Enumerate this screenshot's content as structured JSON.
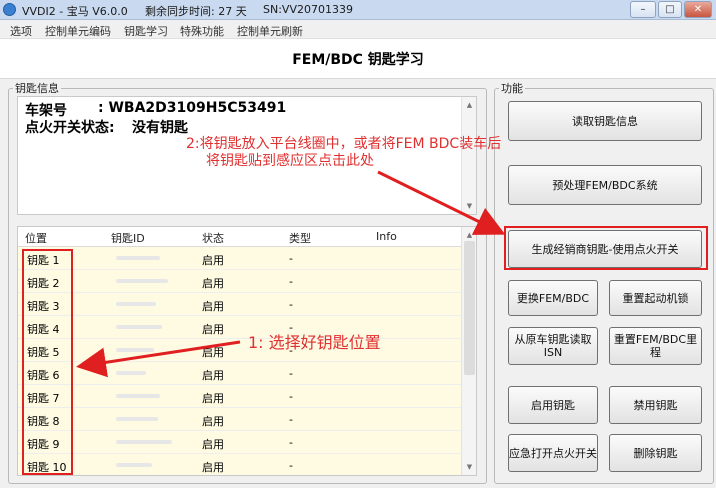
{
  "window": {
    "title_app": "VVDI2 - 宝马 V6.0.0",
    "title_sync": "剩余同步时间: 27 天",
    "title_sn": "SN:VV20701339"
  },
  "menu": [
    "选项",
    "控制单元编码",
    "钥匙学习",
    "特殊功能",
    "控制单元刷新"
  ],
  "header": {
    "title": "FEM/BDC 钥匙学习"
  },
  "key_info": {
    "legend": "钥匙信息",
    "vin_label": "车架号",
    "vin_value": ": WBA2D3109H5C53491",
    "ignition_label": "点火开关状态:",
    "ignition_value": "没有钥匙"
  },
  "annotations": {
    "hint2_line1": "2:将钥匙放入平台线圈中，或者将FEM BDC装车后",
    "hint2_line2": "将钥匙贴到感应区点击此处",
    "hint1": "1: 选择好钥匙位置",
    "color": "#e02020"
  },
  "table": {
    "headers": [
      "位置",
      "钥匙ID",
      "状态",
      "类型",
      "Info"
    ],
    "rows": [
      {
        "pos": "钥匙 1",
        "id": "",
        "status": "启用",
        "type": "-",
        "info": ""
      },
      {
        "pos": "钥匙 2",
        "id": "",
        "status": "启用",
        "type": "-",
        "info": ""
      },
      {
        "pos": "钥匙 3",
        "id": "",
        "status": "启用",
        "type": "-",
        "info": ""
      },
      {
        "pos": "钥匙 4",
        "id": "",
        "status": "启用",
        "type": "-",
        "info": ""
      },
      {
        "pos": "钥匙 5",
        "id": "",
        "status": "启用",
        "type": "-",
        "info": ""
      },
      {
        "pos": "钥匙 6",
        "id": "",
        "status": "启用",
        "type": "-",
        "info": ""
      },
      {
        "pos": "钥匙 7",
        "id": "",
        "status": "启用",
        "type": "-",
        "info": ""
      },
      {
        "pos": "钥匙 8",
        "id": "",
        "status": "启用",
        "type": "-",
        "info": ""
      },
      {
        "pos": "钥匙 9",
        "id": "",
        "status": "启用",
        "type": "-",
        "info": ""
      },
      {
        "pos": "钥匙 10",
        "id": "",
        "status": "启用",
        "type": "-",
        "info": ""
      }
    ],
    "row_bg": "#fffbe3"
  },
  "functions": {
    "legend": "功能",
    "read_key_info": "读取钥匙信息",
    "preprocess": "预处理FEM/BDC系统",
    "gen_dealer_key": "生成经销商钥匙-使用点火开关",
    "replace_fem": "更换FEM/BDC",
    "reset_immo": "重置起动机锁",
    "read_isn_line1": "从原车钥匙读取",
    "read_isn_line2": "ISN",
    "reset_mileage": "重置FEM/BDC里程",
    "enable_key": "启用钥匙",
    "disable_key": "禁用钥匙",
    "emergency_ignition": "应急打开点火开关",
    "delete_key": "删除钥匙"
  }
}
